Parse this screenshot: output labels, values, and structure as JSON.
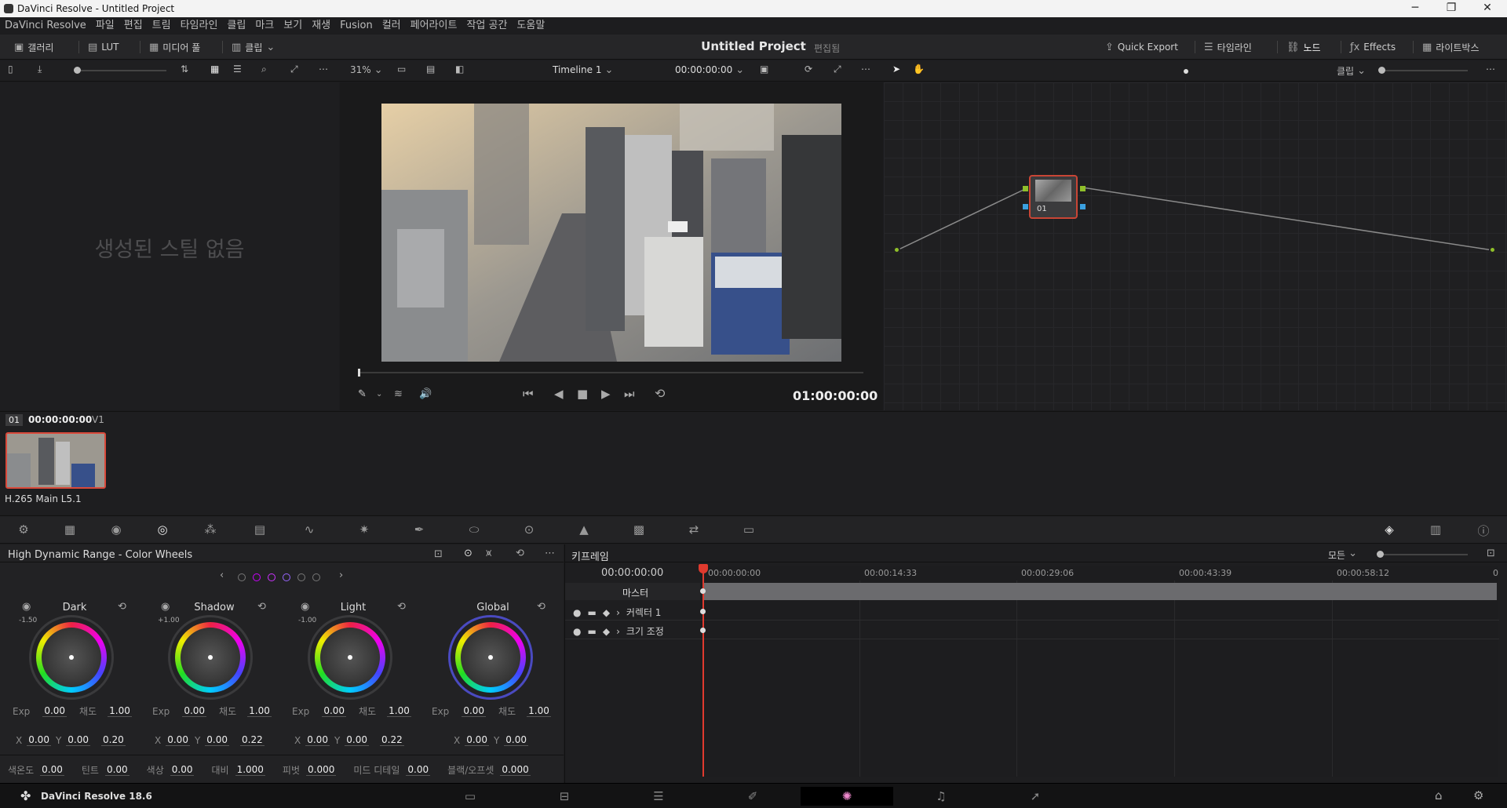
{
  "window": {
    "title": "DaVinci Resolve - Untitled Project"
  },
  "menu": [
    "DaVinci Resolve",
    "파일",
    "편집",
    "트림",
    "타임라인",
    "클립",
    "마크",
    "보기",
    "재생",
    "Fusion",
    "컬러",
    "페어라이트",
    "작업 공간",
    "도움말"
  ],
  "header": {
    "gallery": "갤러리",
    "lut": "LUT",
    "media_pool": "미디어 풀",
    "clips": "클립",
    "project": "Untitled Project",
    "edited": "편집됨",
    "quick_export": "Quick Export",
    "timeline": "타임라인",
    "nodes": "노드",
    "effects": "Effects",
    "lightbox": "라이트박스"
  },
  "viewer_toolbar": {
    "zoom": "31%",
    "timeline": "Timeline 1",
    "timecode": "00:00:00:00",
    "clip_mode": "클립"
  },
  "gallery": {
    "empty": "생성된 스틸 없음"
  },
  "viewer": {
    "timecode": "01:00:00:00"
  },
  "node": {
    "label": "01"
  },
  "clip": {
    "index": "01",
    "timecode": "00:00:00:00",
    "track": "V1",
    "codec": "H.265 Main L5.1"
  },
  "wheels": {
    "title": "High Dynamic Range - Color Wheels",
    "zones": [
      {
        "name": "Dark",
        "ev": "-1.50",
        "exp": "0.00",
        "sat": "1.00",
        "x": "0.00",
        "y": "0.00",
        "z": "0.20"
      },
      {
        "name": "Shadow",
        "ev": "+1.00",
        "exp": "0.00",
        "sat": "1.00",
        "x": "0.00",
        "y": "0.00",
        "z": "0.22"
      },
      {
        "name": "Light",
        "ev": "-1.00",
        "exp": "0.00",
        "sat": "1.00",
        "x": "0.00",
        "y": "0.00",
        "z": "0.22"
      },
      {
        "name": "Global",
        "ev": "",
        "exp": "0.00",
        "sat": "1.00",
        "x": "0.00",
        "y": "0.00",
        "z": ""
      }
    ],
    "labels": {
      "exp": "Exp",
      "sat": "채도",
      "x": "X",
      "y": "Y"
    },
    "bottom": [
      {
        "label": "색온도",
        "value": "0.00"
      },
      {
        "label": "틴트",
        "value": "0.00"
      },
      {
        "label": "색상",
        "value": "0.00"
      },
      {
        "label": "대비",
        "value": "1.000"
      },
      {
        "label": "피벗",
        "value": "0.000"
      },
      {
        "label": "미드 디테일",
        "value": "0.00"
      },
      {
        "label": "블랙/오프셋",
        "value": "0.000"
      }
    ]
  },
  "keyframes": {
    "title": "키프레임",
    "filter": "모든",
    "timecode": "00:00:00:00",
    "ticks": [
      "00:00:00:00",
      "00:00:14:33",
      "00:00:29:06",
      "00:00:43:39",
      "00:00:58:12",
      "0"
    ],
    "rows": [
      "마스터",
      "커렉터 1",
      "크기 조정"
    ]
  },
  "status": {
    "app": "DaVinci Resolve 18.6"
  }
}
